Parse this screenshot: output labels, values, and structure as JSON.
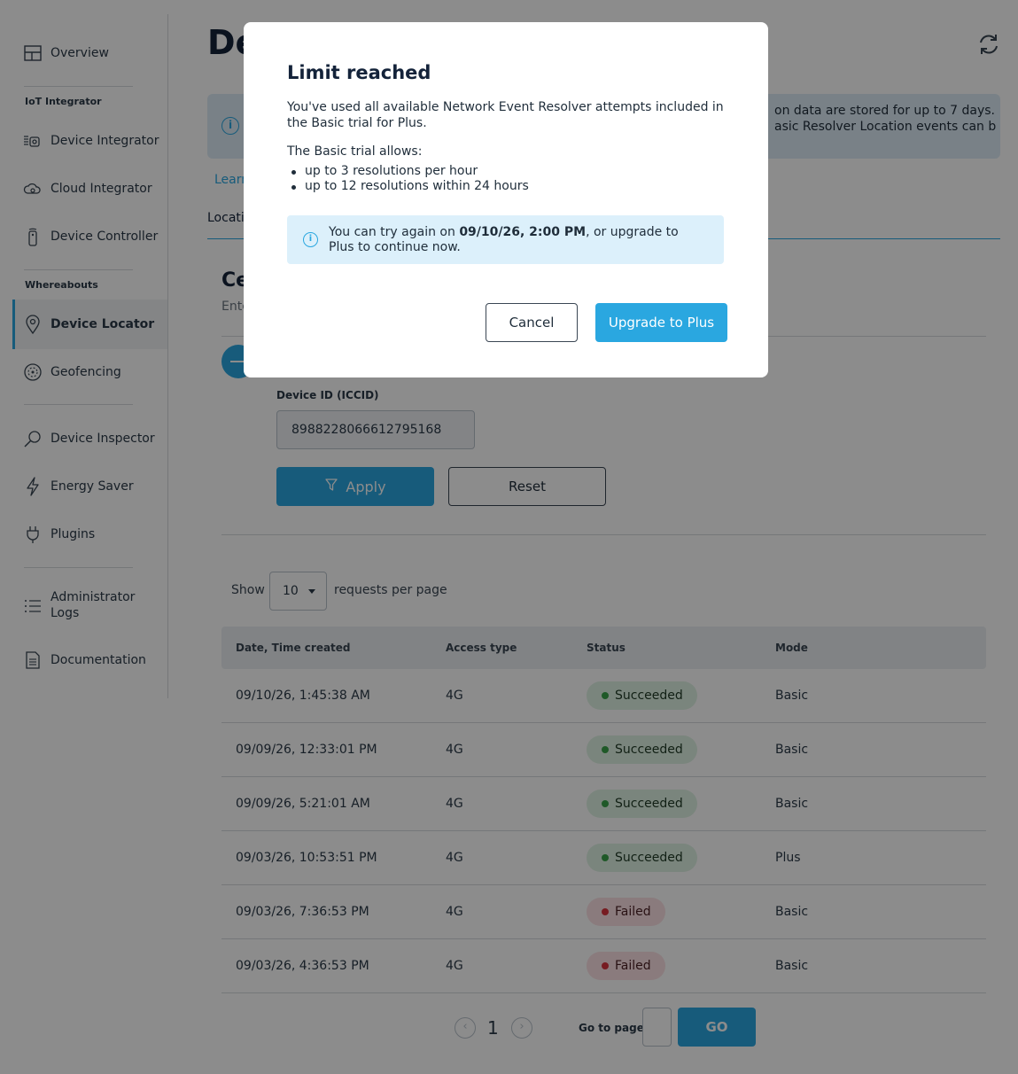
{
  "sidebar": {
    "overview": "Overview",
    "section_iot": "IoT Integrator",
    "device_integrator": "Device Integrator",
    "cloud_integrator": "Cloud Integrator",
    "device_controller": "Device Controller",
    "section_whereabouts": "Whereabouts",
    "device_locator": "Device Locator",
    "geofencing": "Geofencing",
    "device_inspector": "Device Inspector",
    "energy_saver": "Energy Saver",
    "plugins": "Plugins",
    "admin_logs_line1": "Administrator",
    "admin_logs_line2": "Logs",
    "documentation": "Documentation"
  },
  "main": {
    "title_visible": "De",
    "banner_line1": "on data are stored for up to 7 days.",
    "banner_line2": "asic Resolver Location events can be",
    "learn_link": "Learn",
    "tab_label": "Locatio",
    "card_title": "Ce",
    "card_subtitle": "Ente",
    "field_label": "Device ID (ICCID)",
    "field_value": "8988228066612795168",
    "apply_label": "Apply",
    "reset_label": "Reset",
    "show_label": "Show",
    "per_page_value": "10",
    "per_page_label": "requests per page",
    "table": {
      "headers": [
        "Date, Time created",
        "Access type",
        "Status",
        "Mode"
      ],
      "rows": [
        {
          "date": "09/10/26, 1:45:38 AM",
          "access": "4G",
          "status": "Succeeded",
          "mode": "Basic"
        },
        {
          "date": "09/09/26, 12:33:01 PM",
          "access": "4G",
          "status": "Succeeded",
          "mode": "Basic"
        },
        {
          "date": "09/09/26, 5:21:01 AM",
          "access": "4G",
          "status": "Succeeded",
          "mode": "Basic"
        },
        {
          "date": "09/03/26, 10:53:51 PM",
          "access": "4G",
          "status": "Succeeded",
          "mode": "Plus"
        },
        {
          "date": "09/03/26, 7:36:53 PM",
          "access": "4G",
          "status": "Failed",
          "mode": "Basic"
        },
        {
          "date": "09/03/26, 4:36:53 PM",
          "access": "4G",
          "status": "Failed",
          "mode": "Basic"
        }
      ]
    },
    "pager": {
      "prev": "‹",
      "current": "1",
      "next": "›",
      "goto_label": "Go to page",
      "go_label": "GO"
    }
  },
  "modal": {
    "title": "Limit reached",
    "paragraph": "You've used all available Network Event Resolver attempts included in the Basic trial for Plus.",
    "allows_label": "The Basic trial allows:",
    "list": [
      "up to 3 resolutions per hour",
      "up to 12 resolutions within 24 hours"
    ],
    "note_prefix": "You can try again on ",
    "note_date": "09/10/26, 2:00 PM",
    "note_suffix": ", or upgrade to Plus to continue now.",
    "cancel_label": "Cancel",
    "upgrade_label": "Upgrade to Plus"
  },
  "colors": {
    "accent": "#2aa7e0",
    "success": "#3aa34a",
    "failure": "#d9343f"
  }
}
